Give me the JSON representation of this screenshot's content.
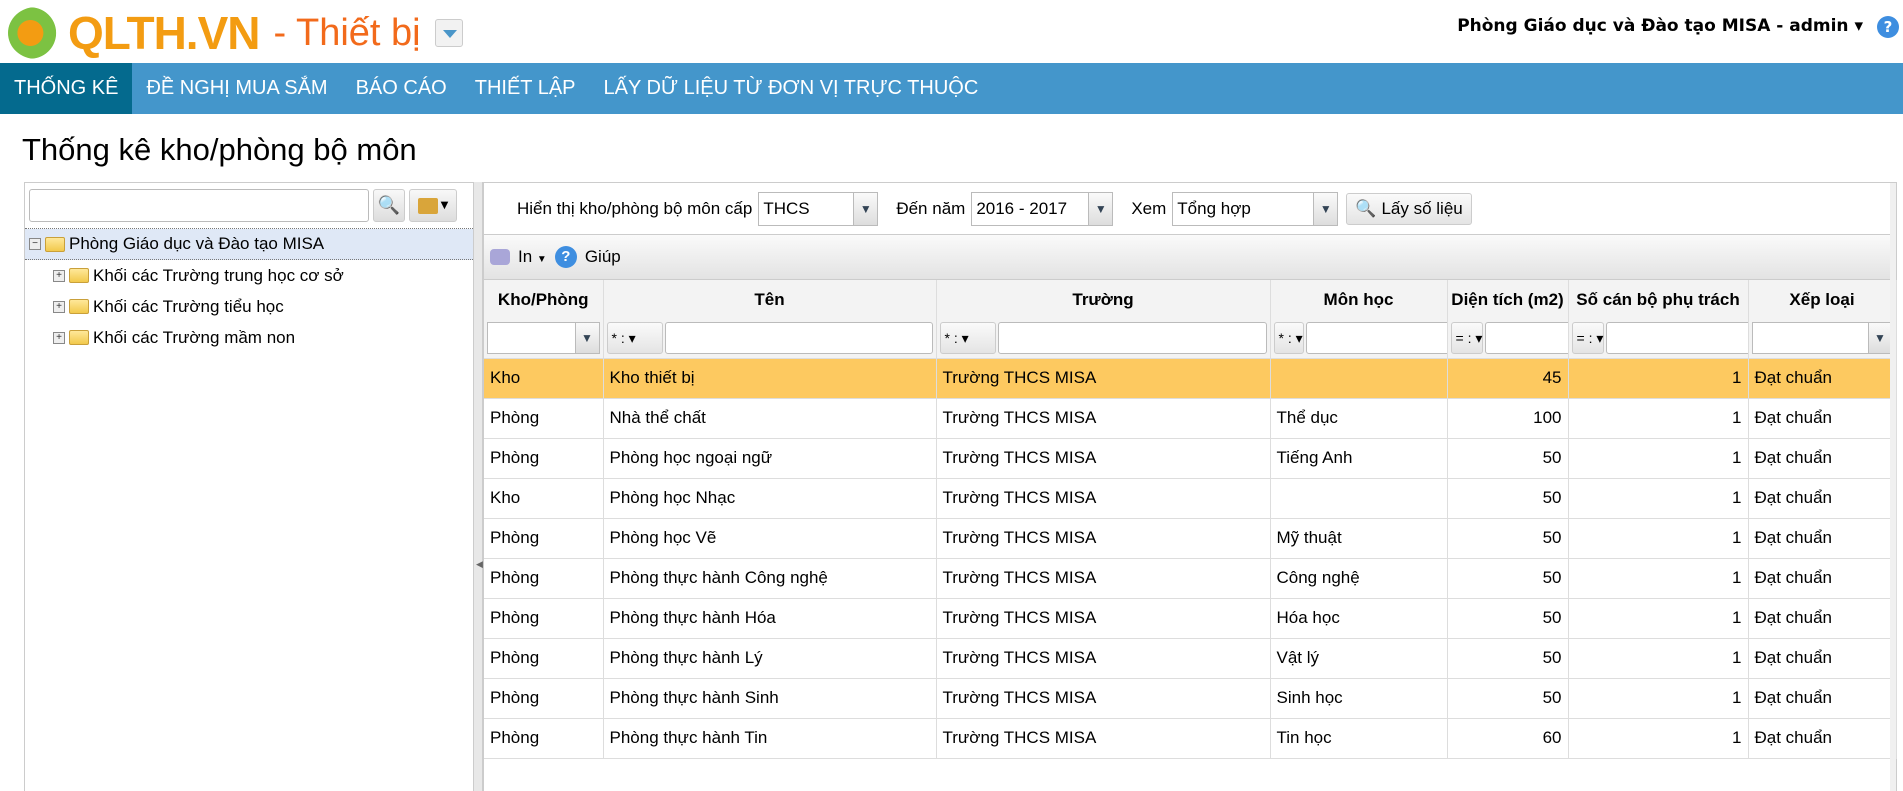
{
  "header": {
    "logo": "QLTH.VN",
    "module": "- Thiết bị",
    "user": "Phòng Giáo dục và Đào tạo MISA - admin",
    "help": "?"
  },
  "nav": [
    "THỐNG KÊ",
    "ĐỀ NGHỊ MUA SẮM",
    "BÁO CÁO",
    "THIẾT LẬP",
    "LẤY DỮ LIỆU TỪ ĐƠN VỊ TRỰC THUỘC"
  ],
  "page_title": "Thống kê kho/phòng bộ môn",
  "tree": {
    "root": "Phòng Giáo dục và Đào tạo MISA",
    "children": [
      "Khối các Trường trung học cơ sở",
      "Khối các Trường tiểu học",
      "Khối các Trường mầm non"
    ]
  },
  "filters": {
    "level_label": "Hiển thị kho/phòng bộ môn cấp",
    "level": "THCS",
    "year_label": "Đến năm",
    "year": "2016 - 2017",
    "view_label": "Xem",
    "view": "Tổng hợp",
    "get_button": "Lấy số liệu"
  },
  "toolbar": {
    "print": "In",
    "help": "Giúp"
  },
  "table": {
    "columns": [
      "Kho/Phòng",
      "Tên",
      "Trường",
      "Môn học",
      "Diện tích (m2)",
      "Số cán bộ phụ trách",
      "Xếp loại"
    ],
    "filter_ops": {
      "ten": "* :",
      "truong": "* :",
      "mon": "* :",
      "dientich": "= :",
      "socanbo": "= :"
    },
    "rows": [
      [
        "Kho",
        "Kho thiết bị",
        "Trường THCS MISA",
        "",
        "45",
        "1",
        "Đạt chuẩn"
      ],
      [
        "Phòng",
        "Nhà thể chất",
        "Trường THCS MISA",
        "Thể dục",
        "100",
        "1",
        "Đạt chuẩn"
      ],
      [
        "Phòng",
        "Phòng học ngoại ngữ",
        "Trường THCS MISA",
        "Tiếng Anh",
        "50",
        "1",
        "Đạt chuẩn"
      ],
      [
        "Kho",
        "Phòng học Nhạc",
        "Trường THCS MISA",
        "",
        "50",
        "1",
        "Đạt chuẩn"
      ],
      [
        "Phòng",
        "Phòng học Vẽ",
        "Trường THCS MISA",
        "Mỹ thuật",
        "50",
        "1",
        "Đạt chuẩn"
      ],
      [
        "Phòng",
        "Phòng thực hành Công nghệ",
        "Trường THCS MISA",
        "Công nghệ",
        "50",
        "1",
        "Đạt chuẩn"
      ],
      [
        "Phòng",
        "Phòng thực hành Hóa",
        "Trường THCS MISA",
        "Hóa học",
        "50",
        "1",
        "Đạt chuẩn"
      ],
      [
        "Phòng",
        "Phòng thực hành Lý",
        "Trường THCS MISA",
        "Vật lý",
        "50",
        "1",
        "Đạt chuẩn"
      ],
      [
        "Phòng",
        "Phòng thực hành Sinh",
        "Trường THCS MISA",
        "Sinh học",
        "50",
        "1",
        "Đạt chuẩn"
      ],
      [
        "Phòng",
        "Phòng thực hành Tin",
        "Trường THCS MISA",
        "Tin học",
        "60",
        "1",
        "Đạt chuẩn"
      ]
    ]
  }
}
